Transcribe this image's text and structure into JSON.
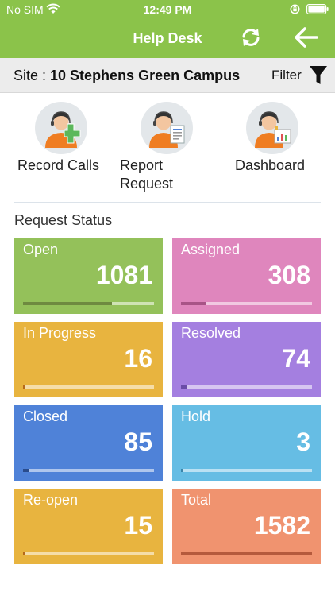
{
  "status_bar": {
    "carrier": "No SIM",
    "time": "12:49 PM"
  },
  "header": {
    "title": "Help Desk",
    "background": "#8bc34a"
  },
  "site_bar": {
    "label": "Site : ",
    "site_name": "10 Stephens Green Campus",
    "filter_label": "Filter"
  },
  "tiles": [
    {
      "line1": "Record Calls",
      "line2": "",
      "icon": "record-calls-icon"
    },
    {
      "line1": "Report",
      "line2": "Request",
      "icon": "report-request-icon"
    },
    {
      "line1": "Dashboard",
      "line2": "",
      "icon": "dashboard-icon"
    }
  ],
  "request_status": {
    "title": "Request Status",
    "cards": [
      {
        "label": "Open",
        "count": "1081",
        "progress": 0.68,
        "color": "#94c15a",
        "fill": "#6e8a40"
      },
      {
        "label": "Assigned",
        "count": "308",
        "progress": 0.19,
        "color": "#df86bd",
        "fill": "#a85487"
      },
      {
        "label": "In Progress",
        "count": "16",
        "progress": 0.01,
        "color": "#e8b43f",
        "fill": "#b5691a"
      },
      {
        "label": "Resolved",
        "count": "74",
        "progress": 0.05,
        "color": "#a47fe0",
        "fill": "#6a4ca8"
      },
      {
        "label": "Closed",
        "count": "85",
        "progress": 0.05,
        "color": "#4f82d8",
        "fill": "#2a4c8c"
      },
      {
        "label": "Hold",
        "count": "3",
        "progress": 0.002,
        "color": "#66bde4",
        "fill": "#3a85aa"
      },
      {
        "label": "Re-open",
        "count": "15",
        "progress": 0.01,
        "color": "#e8b43f",
        "fill": "#b5691a"
      },
      {
        "label": "Total",
        "count": "1582",
        "progress": 1.0,
        "color": "#f0936f",
        "fill": "#b55a3c"
      }
    ]
  }
}
